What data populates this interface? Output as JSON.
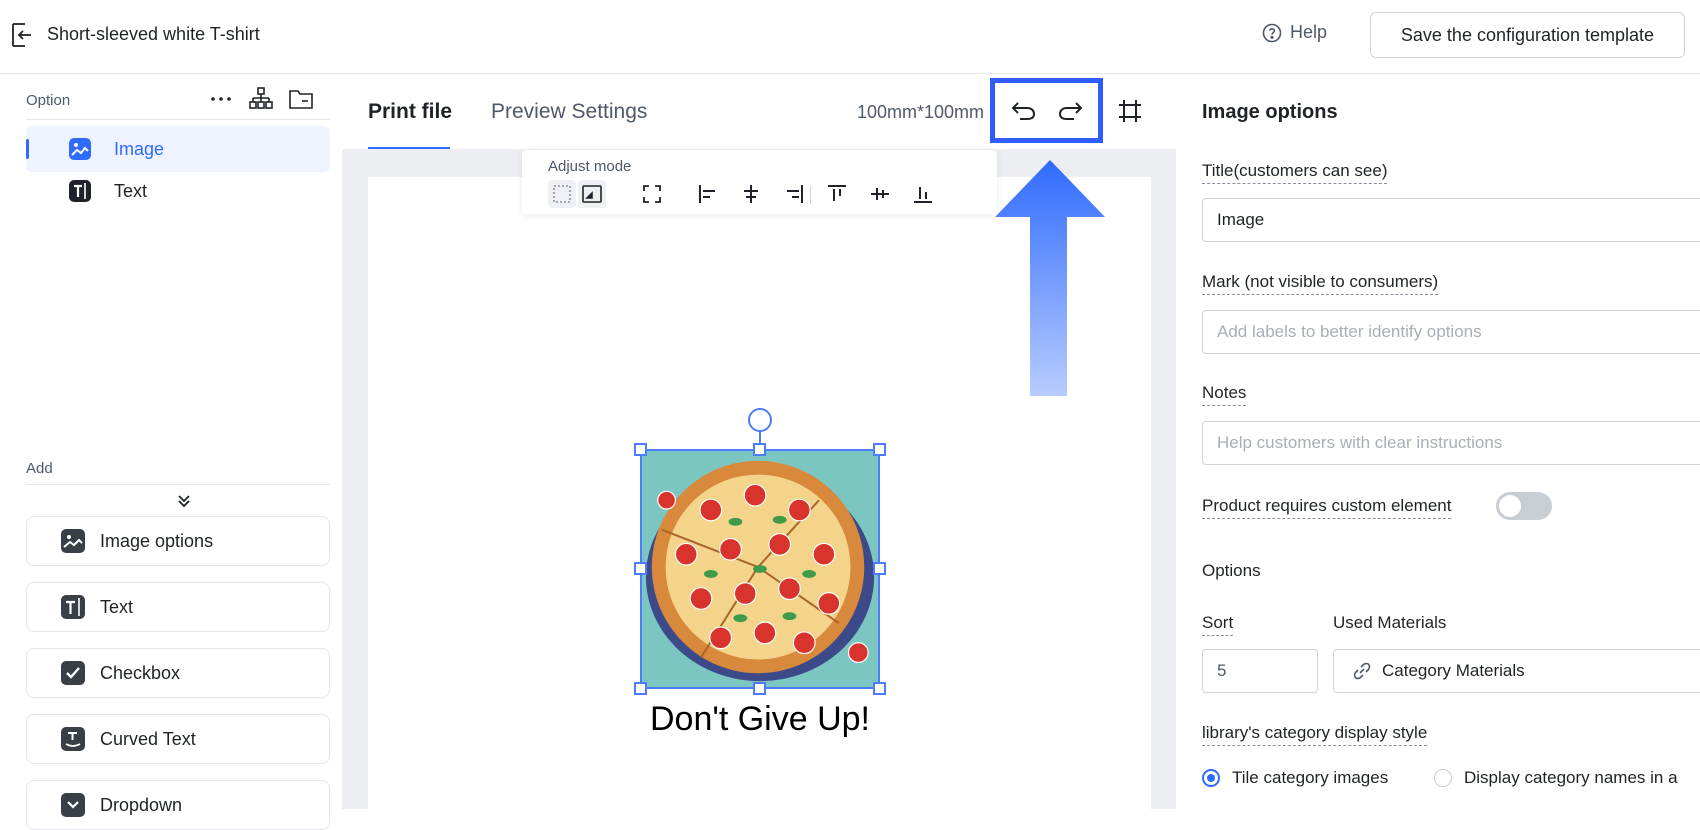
{
  "header": {
    "product_title": "Short-sleeved white T-shirt",
    "help_label": "Help",
    "save_label": "Save the configuration template"
  },
  "sidebar": {
    "option_label": "Option",
    "layers": [
      {
        "label": "Image",
        "icon": "image-icon",
        "active": true
      },
      {
        "label": "Text",
        "icon": "text-icon",
        "active": false
      }
    ],
    "add_label": "Add",
    "add_items": [
      {
        "label": "Image options",
        "icon": "image-icon"
      },
      {
        "label": "Text",
        "icon": "text-icon"
      },
      {
        "label": "Checkbox",
        "icon": "checkbox-icon"
      },
      {
        "label": "Curved Text",
        "icon": "curved-text-icon"
      },
      {
        "label": "Dropdown",
        "icon": "dropdown-icon"
      }
    ]
  },
  "center": {
    "tabs": [
      {
        "label": "Print file",
        "active": true
      },
      {
        "label": "Preview Settings",
        "active": false
      }
    ],
    "size": "100mm*100mm",
    "toolbar_label": "Adjust mode",
    "caption": "Don't Give Up!",
    "accent_color": "#2f6bff",
    "highlight_color": "#2f5bff"
  },
  "panel": {
    "title": "Image options",
    "title_label": "Title(customers can see)",
    "title_value": "Image",
    "mark_label": "Mark (not visible to consumers)",
    "mark_placeholder": "Add labels to better identify options",
    "notes_label": "Notes",
    "notes_placeholder": "Help customers with clear instructions",
    "custom_label": "Product requires custom element",
    "custom_enabled": false,
    "options_label": "Options",
    "sort_label": "Sort",
    "sort_value": "5",
    "materials_label": "Used Materials",
    "materials_button": "Category Materials",
    "display_style_label": "library's category display style",
    "display_options": [
      {
        "label": "Tile category images",
        "checked": true
      },
      {
        "label": "Display category names in a",
        "checked": false
      }
    ]
  }
}
